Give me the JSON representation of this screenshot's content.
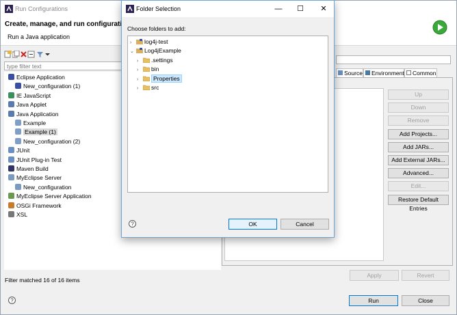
{
  "main_window": {
    "title": "Run Configurations",
    "heading": "Create, manage, and run configuration",
    "subheading": "Run a Java application"
  },
  "left_panel": {
    "filter_placeholder": "type filter text",
    "tree": [
      {
        "label": "Eclipse Application",
        "level": 0,
        "icon": "eclipse-app-icon",
        "color": "#3a4fa0"
      },
      {
        "label": "New_configuration (1)",
        "level": 1,
        "icon": "eclipse-config-icon",
        "color": "#3a4fa0"
      },
      {
        "label": "IE JavaScript",
        "level": 0,
        "icon": "ie-javascript-icon",
        "color": "#3b8f5c"
      },
      {
        "label": "Java Applet",
        "level": 0,
        "icon": "java-applet-icon",
        "color": "#5a7ab0"
      },
      {
        "label": "Java Application",
        "level": 0,
        "icon": "java-application-icon",
        "color": "#5a7ab0"
      },
      {
        "label": "Example",
        "level": 1,
        "icon": "java-class-icon",
        "color": "#7f9fc7"
      },
      {
        "label": "Example (1)",
        "level": 1,
        "icon": "java-class-icon",
        "color": "#7f9fc7",
        "selected": true
      },
      {
        "label": "New_configuration (2)",
        "level": 1,
        "icon": "java-class-icon",
        "color": "#7f9fc7"
      },
      {
        "label": "JUnit",
        "level": 0,
        "icon": "junit-icon",
        "color": "#6a8fc0"
      },
      {
        "label": "JUnit Plug-in Test",
        "level": 0,
        "icon": "junit-plugin-icon",
        "color": "#6a8fc0"
      },
      {
        "label": "Maven Build",
        "level": 0,
        "icon": "maven-icon",
        "color": "#333366"
      },
      {
        "label": "MyEclipse Server",
        "level": 0,
        "icon": "myeclipse-server-icon",
        "color": "#7a9ac0"
      },
      {
        "label": "New_configuration",
        "level": 1,
        "icon": "server-config-icon",
        "color": "#7a9ac0"
      },
      {
        "label": "MyEclipse Server Application",
        "level": 0,
        "icon": "server-app-icon",
        "color": "#6a9a50"
      },
      {
        "label": "OSGi Framework",
        "level": 0,
        "icon": "osgi-icon",
        "color": "#c77b2a"
      },
      {
        "label": "XSL",
        "level": 0,
        "icon": "xsl-icon",
        "color": "#777777"
      }
    ],
    "filter_status": "Filter matched 16 of 16 items"
  },
  "right_panel": {
    "tabs": [
      "Source",
      "Environment",
      "Common"
    ],
    "side_buttons": [
      {
        "label": "Up",
        "disabled": true
      },
      {
        "label": "Down",
        "disabled": true
      },
      {
        "label": "Remove",
        "disabled": true
      },
      {
        "label": "Add Projects...",
        "disabled": false
      },
      {
        "label": "Add JARs...",
        "disabled": false
      },
      {
        "label": "Add External JARs...",
        "disabled": false
      },
      {
        "label": "Advanced...",
        "disabled": false
      },
      {
        "label": "Edit...",
        "disabled": true
      },
      {
        "label": "Restore Default Entries",
        "disabled": false
      }
    ],
    "apply_label": "Apply",
    "revert_label": "Revert"
  },
  "bottom": {
    "run_label": "Run",
    "close_label": "Close"
  },
  "dialog": {
    "title": "Folder Selection",
    "prompt": "Choose folders to add:",
    "tree": [
      {
        "label": "log4j-test",
        "level": 0,
        "arrow": ">",
        "icon": "project-icon"
      },
      {
        "label": "Log4jExample",
        "level": 0,
        "arrow": "v",
        "icon": "project-icon"
      },
      {
        "label": ".settings",
        "level": 1,
        "arrow": ">",
        "icon": "folder-icon"
      },
      {
        "label": "bin",
        "level": 1,
        "arrow": ">",
        "icon": "folder-icon"
      },
      {
        "label": "Properties",
        "level": 1,
        "arrow": ">",
        "icon": "folder-icon",
        "selected": true
      },
      {
        "label": "src",
        "level": 1,
        "arrow": ">",
        "icon": "folder-icon"
      }
    ],
    "ok_label": "OK",
    "cancel_label": "Cancel",
    "minimize_glyph": "—",
    "maximize_glyph": "☐",
    "close_glyph": "✕"
  }
}
